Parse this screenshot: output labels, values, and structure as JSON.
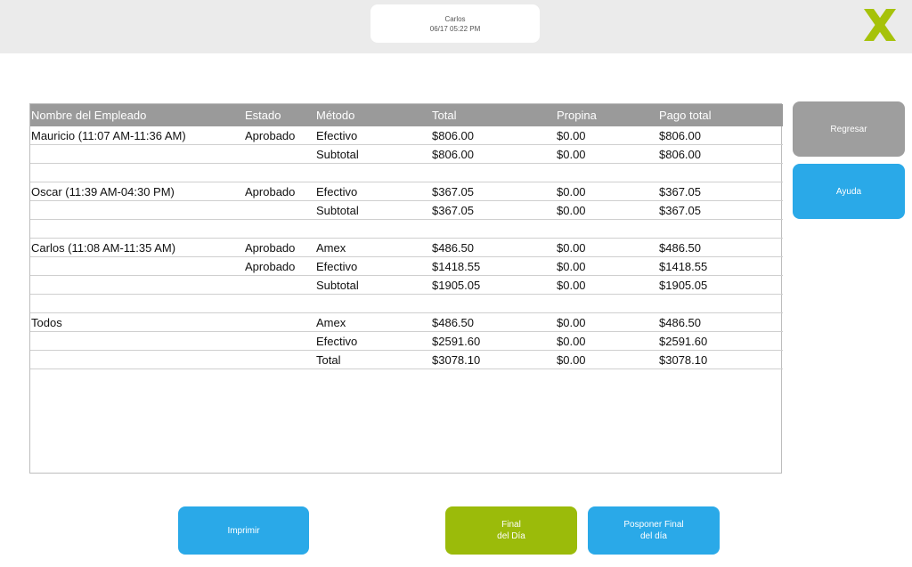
{
  "header": {
    "user_name": "Carlos",
    "datetime": "06/17 05:22 PM",
    "logo_icon": "x-logo-icon",
    "logo_color": "#a6c20a"
  },
  "table": {
    "columns": [
      "Nombre del Empleado",
      "Estado",
      "Método",
      "Total",
      "Propina",
      "Pago total"
    ],
    "rows": [
      [
        "Mauricio (11:07 AM-11:36 AM)",
        "Aprobado",
        "Efectivo",
        "$806.00",
        "$0.00",
        "$806.00"
      ],
      [
        "",
        "",
        "Subtotal",
        "$806.00",
        "$0.00",
        "$806.00"
      ],
      [
        "",
        "",
        "",
        "",
        "",
        ""
      ],
      [
        "Oscar (11:39 AM-04:30 PM)",
        "Aprobado",
        "Efectivo",
        "$367.05",
        "$0.00",
        "$367.05"
      ],
      [
        "",
        "",
        "Subtotal",
        "$367.05",
        "$0.00",
        "$367.05"
      ],
      [
        "",
        "",
        "",
        "",
        "",
        ""
      ],
      [
        "Carlos (11:08 AM-11:35 AM)",
        "Aprobado",
        "Amex",
        "$486.50",
        "$0.00",
        "$486.50"
      ],
      [
        "",
        "Aprobado",
        "Efectivo",
        "$1418.55",
        "$0.00",
        "$1418.55"
      ],
      [
        "",
        "",
        "Subtotal",
        "$1905.05",
        "$0.00",
        "$1905.05"
      ],
      [
        "",
        "",
        "",
        "",
        "",
        ""
      ],
      [
        "Todos",
        "",
        "Amex",
        "$486.50",
        "$0.00",
        "$486.50"
      ],
      [
        "",
        "",
        "Efectivo",
        "$2591.60",
        "$0.00",
        "$2591.60"
      ],
      [
        "",
        "",
        "Total",
        "$3078.10",
        "$0.00",
        "$3078.10"
      ]
    ]
  },
  "side": {
    "back_label": "Regresar",
    "help_label": "Ayuda"
  },
  "footer": {
    "print_label": "Imprimir",
    "end_day_label": "Final\ndel Día",
    "postpone_label": "Posponer Final\ndel día"
  },
  "colors": {
    "header_bg": "#ebebeb",
    "table_header_bg": "#9a9a9a",
    "blue": "#2aa9e8",
    "gray": "#9e9e9e",
    "green": "#9bbb0a"
  }
}
